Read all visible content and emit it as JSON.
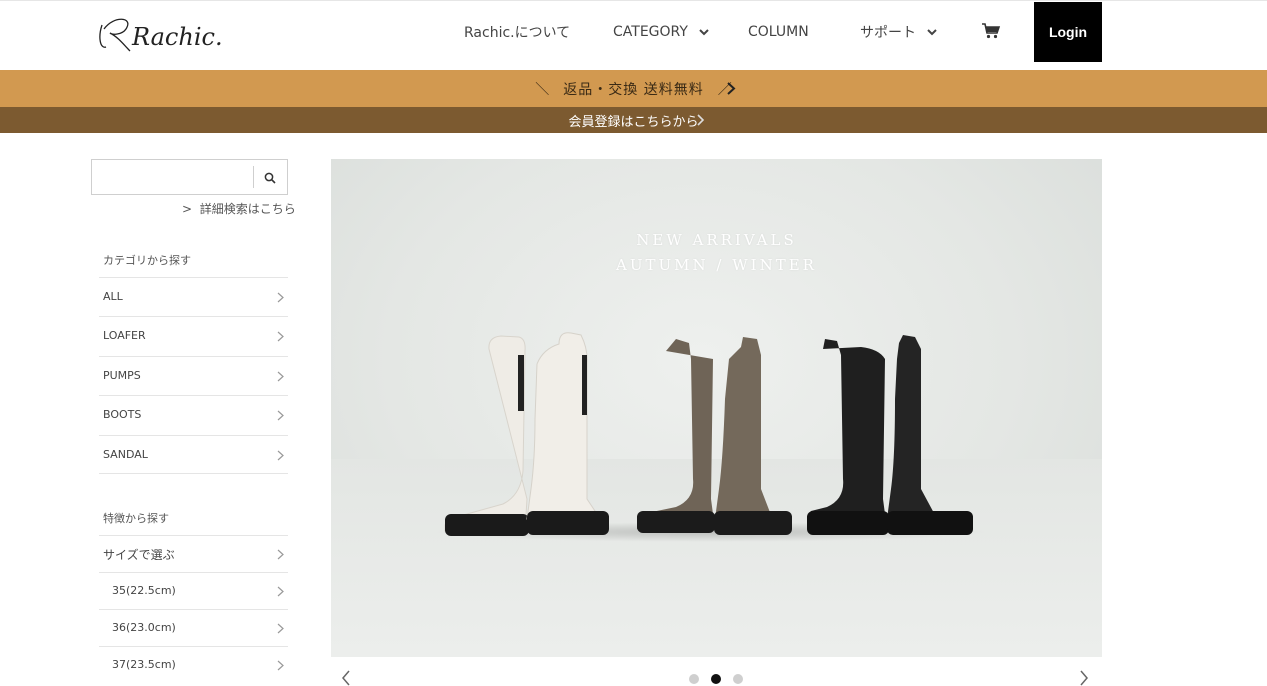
{
  "header": {
    "logo_text": "Rachic.",
    "nav": {
      "about": "Rachic.について",
      "category": "CATEGORY",
      "column": "COLUMN",
      "support": "サポート"
    },
    "login_label": "Login"
  },
  "banner1": {
    "left_deco": "＼",
    "text": "返品・交換 送料無料",
    "right_deco": "／"
  },
  "banner2": {
    "text": "会員登録はこちらから"
  },
  "sidebar": {
    "search_placeholder": "",
    "advanced_search": "詳細検索はこちら",
    "category_heading": "カテゴリから探す",
    "categories": [
      "ALL",
      "LOAFER",
      "PUMPS",
      "BOOTS",
      "SANDAL"
    ],
    "feature_heading": "特徴から探す",
    "sizes": [
      "サイズで選ぶ",
      "35(22.5cm)",
      "36(23.0cm)",
      "37(23.5cm)"
    ]
  },
  "hero": {
    "line1": "NEW ARRIVALS",
    "line2": "AUTUMN / WINTER"
  },
  "carousel": {
    "slide_count": 3,
    "active_index": 1
  },
  "colors": {
    "banner1_bg": "#d29950",
    "banner2_bg": "#7c5a30",
    "login_bg": "#000000",
    "boot_white": "#efece6",
    "boot_brown": "#6f6457",
    "boot_black": "#1f1f1f"
  }
}
